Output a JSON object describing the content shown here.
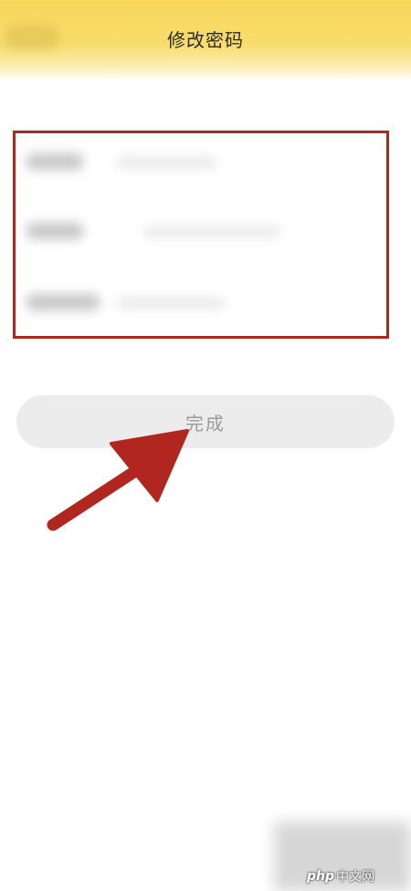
{
  "header": {
    "title": "修改密码",
    "back_icon": "back-arrow-icon",
    "color": "#f7d65a"
  },
  "form": {
    "fields": [
      {
        "id": "current-password",
        "label": "",
        "value": ""
      },
      {
        "id": "new-password",
        "label": "",
        "value": ""
      },
      {
        "id": "confirm-password",
        "label": "",
        "value": ""
      }
    ],
    "annotation_color": "#b1261e"
  },
  "actions": {
    "done_label": "完成",
    "done_bg": "#ececec",
    "done_text_color": "#9a9a9a"
  },
  "annotation": {
    "type": "arrow",
    "color": "#b1261e"
  },
  "watermark": {
    "logo": "php",
    "text": "中文网"
  }
}
